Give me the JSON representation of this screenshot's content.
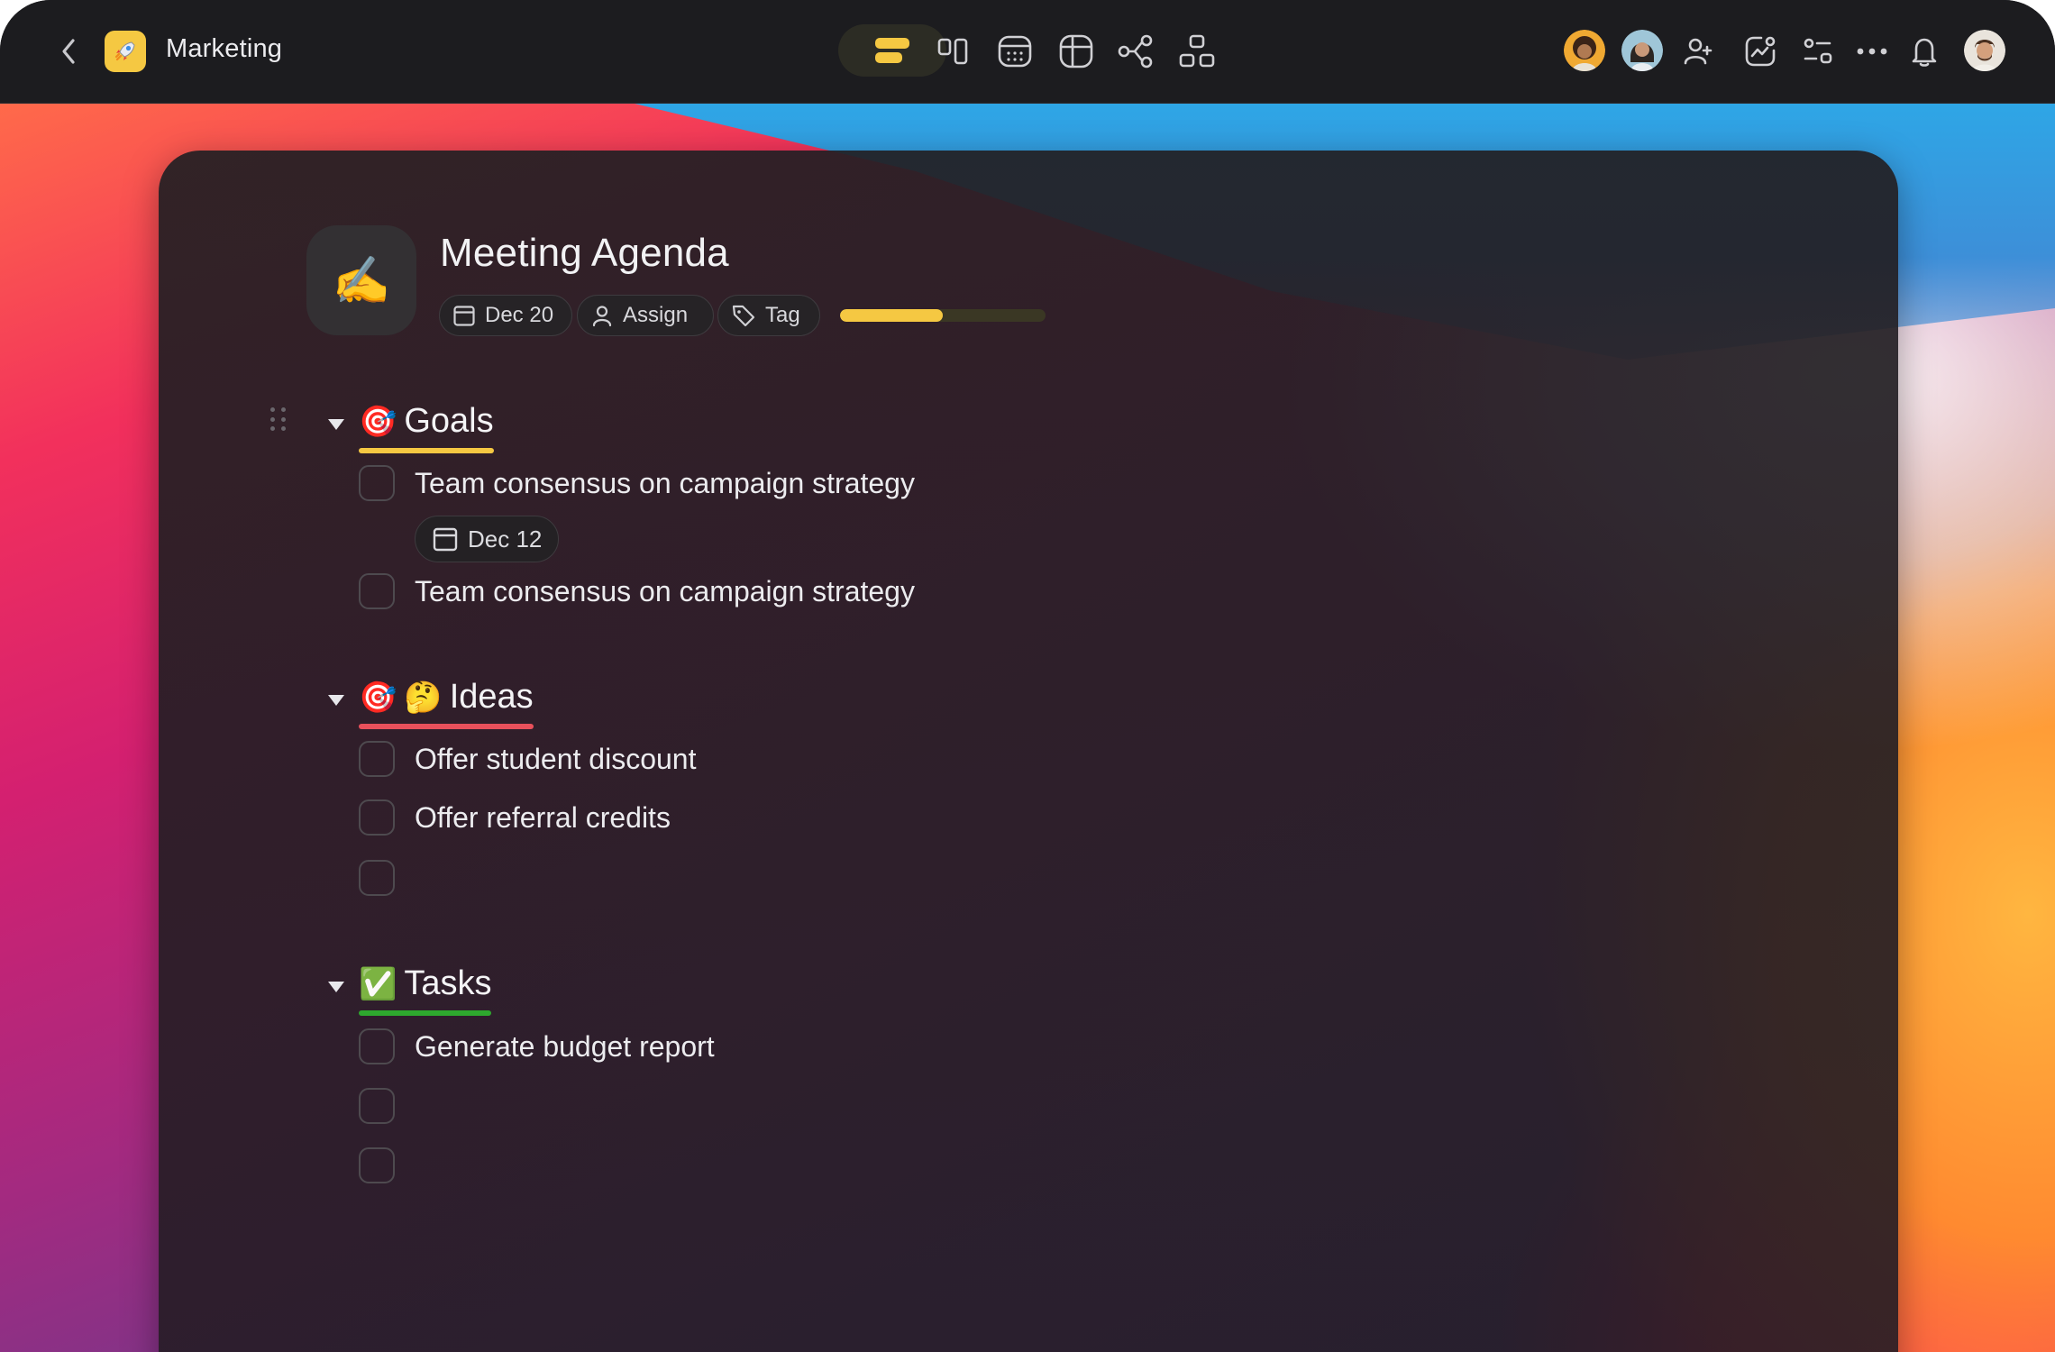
{
  "titlebar": {
    "app_title": "Marketing",
    "app_icon": "rocket-icon",
    "view_icons": [
      "outline-view-icon",
      "board-view-icon",
      "calendar-view-icon",
      "table-view-icon",
      "mindmap-view-icon",
      "flowchart-view-icon"
    ],
    "right_icons": [
      "add-member-icon",
      "activity-icon",
      "settings-sliders-icon",
      "more-icon",
      "bell-icon"
    ],
    "accent": "#f5c842"
  },
  "document": {
    "icon": "writing-hand-icon",
    "title": "Meeting Agenda",
    "meta": {
      "date_label": "Dec 20",
      "assign_label": "Assign",
      "tag_label": "Tag",
      "progress": 0.5
    }
  },
  "sections": [
    {
      "title": "Goals",
      "emojis": [
        "🎯"
      ],
      "underline_color": "#f5c842",
      "items": [
        {
          "text": "Team consensus on campaign strategy",
          "checked": false,
          "date": "Dec 12"
        },
        {
          "text": "Team consensus on campaign strategy",
          "checked": false
        }
      ]
    },
    {
      "title": "Ideas",
      "emojis": [
        "🎯",
        "🤔"
      ],
      "underline_color": "#e8505b",
      "items": [
        {
          "text": "Offer student discount",
          "checked": false
        },
        {
          "text": "Offer referral credits",
          "checked": false
        },
        {
          "text": "",
          "checked": false
        }
      ]
    },
    {
      "title": "Tasks",
      "emojis": [
        "✅"
      ],
      "underline_color": "#2ea82e",
      "items": [
        {
          "text": "Generate budget report",
          "checked": false
        },
        {
          "text": "",
          "checked": false
        },
        {
          "text": "",
          "checked": false
        }
      ]
    }
  ]
}
